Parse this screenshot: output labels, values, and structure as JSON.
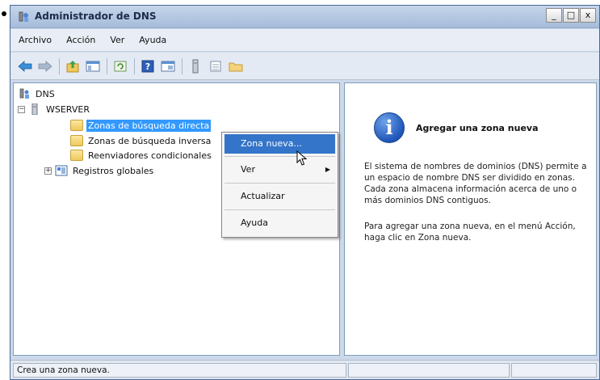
{
  "window": {
    "title": "Administrador de DNS",
    "controls": {
      "minimize": "_",
      "maximize": "□",
      "close": "x"
    }
  },
  "menubar": {
    "items": [
      "Archivo",
      "Acción",
      "Ver",
      "Ayuda"
    ]
  },
  "toolbar": {
    "icons": [
      "back-arrow-icon",
      "forward-arrow-icon",
      "up-folder-icon",
      "show-hide-tree-icon",
      "refresh-icon",
      "help-icon",
      "properties-icon",
      "server-icon",
      "list-icon",
      "folder-icon"
    ]
  },
  "tree": {
    "root": "DNS",
    "server": "WSERVER",
    "expander_server": "−",
    "expander_global": "+",
    "items": [
      {
        "label": "Zonas de búsqueda directa"
      },
      {
        "label": "Zonas de búsqueda inversa"
      },
      {
        "label": "Reenviadores condicionales"
      },
      {
        "label": "Registros globales"
      }
    ]
  },
  "context_menu": {
    "items": [
      {
        "label": "Zona nueva..."
      },
      {
        "label": "Ver"
      },
      {
        "label": "Actualizar"
      },
      {
        "label": "Ayuda"
      }
    ],
    "submenu_arrow": "▶"
  },
  "info": {
    "icon_glyph": "i",
    "title": "Agregar una zona nueva",
    "paragraph1": "El sistema de nombres de dominios (DNS) permite a un espacio de nombre DNS ser dividido en zonas. Cada zona almacena información acerca de uno o más dominios DNS contiguos.",
    "paragraph2": "Para agregar una zona nueva, en el menú Acción, haga clic en Zona nueva."
  },
  "statusbar": {
    "text": "Crea una zona nueva."
  },
  "colors": {
    "selection": "#3399ff",
    "menu_highlight": "#3474c9",
    "window_frame": "#cdd9ea"
  }
}
